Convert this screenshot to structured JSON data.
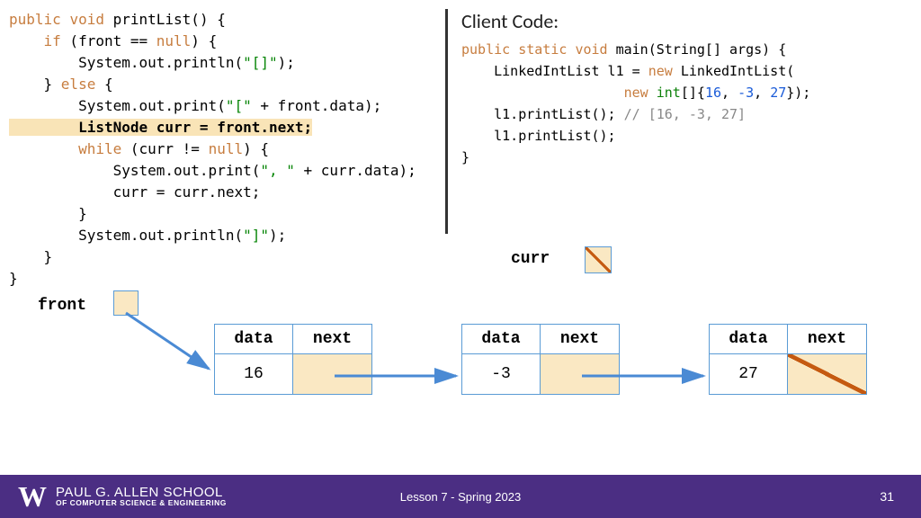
{
  "leftCode": {
    "sig_kw1": "public",
    "sig_kw2": "void",
    "sig_name": "printList() {",
    "if_kw": "if",
    "if_cond": " (front == ",
    "null_kw": "null",
    "if_close": ") {",
    "print1a": "        System.out.println(",
    "print1b": "\"[]\"",
    "print1c": ");",
    "else_line": "    } ",
    "else_kw": "else",
    "else_brace": " {",
    "print2a": "        System.out.print(",
    "print2b": "\"[\"",
    "print2c": " + front.data);",
    "hl_line": "        ListNode curr = front.next;",
    "while_kw": "while",
    "while_a": "        ",
    "while_b": " (curr != ",
    "while_c": ") {",
    "print3a": "            System.out.print(",
    "print3b": "\", \"",
    "print3c": " + curr.data);",
    "assign": "            curr = curr.next;",
    "close1": "        }",
    "print4a": "        System.out.println(",
    "print4b": "\"]\"",
    "print4c": ");",
    "close2": "    }",
    "close3": "}"
  },
  "clientTitle": "Client Code:",
  "rightCode": {
    "r1_kw1": "public",
    "r1_kw2": "static",
    "r1_kw3": "void",
    "r1_rest": " main(String[] args) {",
    "r2a": "    LinkedIntList l1 = ",
    "r2_kw": "new",
    "r2b": " LinkedIntList(",
    "r3a": "                    ",
    "r3_kw": "new",
    "r3b": " ",
    "r3_type": "int",
    "r3c": "[]{",
    "r3_n1": "16",
    "r3_n2": "-3",
    "r3_n3": "27",
    "r3d": ", ",
    "r3e": "});",
    "r4a": "    l1.printList(); ",
    "r4_cmt": "// [16, -3, 27]",
    "r5": "    l1.printList();",
    "r6": "}"
  },
  "diagram": {
    "curr": "curr",
    "front": "front",
    "hdr_data": "data",
    "hdr_next": "next",
    "node1_val": "16",
    "node2_val": "-3",
    "node3_val": "27"
  },
  "footer": {
    "w": "W",
    "school_main": "PAUL G. ALLEN SCHOOL",
    "school_sub": "OF COMPUTER SCIENCE & ENGINEERING",
    "lesson": "Lesson 7 - Spring 2023",
    "page": "31"
  }
}
